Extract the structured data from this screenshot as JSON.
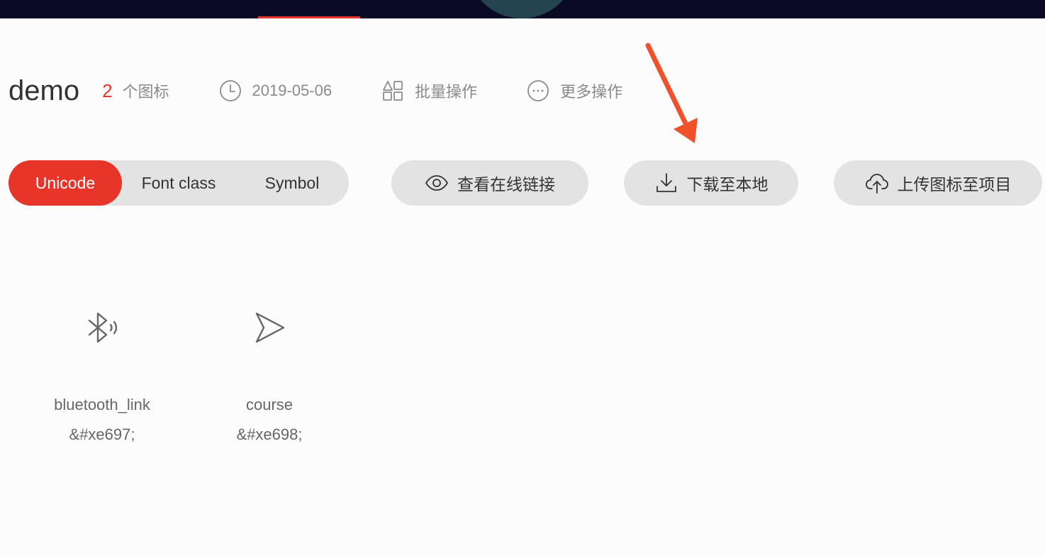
{
  "header": {
    "project_name": "demo",
    "icon_count": "2",
    "icon_count_unit": "个图标",
    "date": "2019-05-06",
    "batch_label": "批量操作",
    "more_label": "更多操作"
  },
  "tabs": {
    "items": [
      "Unicode",
      "Font class",
      "Symbol"
    ],
    "active": "Unicode"
  },
  "actions": {
    "view_online": "查看在线链接",
    "download": "下载至本地",
    "upload": "上传图标至项目"
  },
  "icons": [
    {
      "name": "bluetooth_link",
      "code": "&#xe697;",
      "icon": "bluetooth-link-icon"
    },
    {
      "name": "course",
      "code": "&#xe698;",
      "icon": "send-arrow-icon"
    }
  ],
  "colors": {
    "accent": "#e8352a",
    "topbar": "#0b0a26",
    "pill_bg": "#e3e3e3",
    "annotation_arrow": "#f0502a"
  }
}
